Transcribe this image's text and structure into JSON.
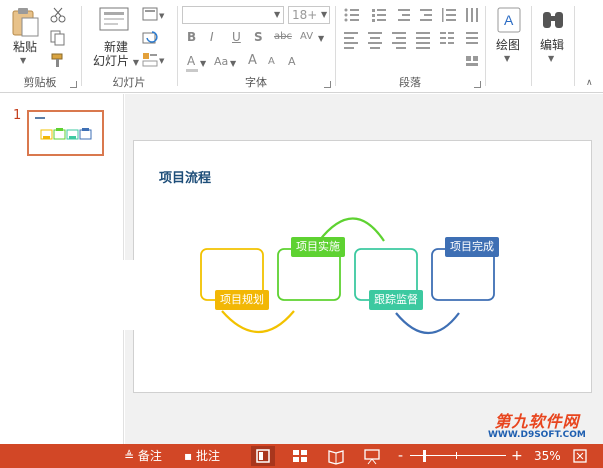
{
  "ribbon": {
    "clipboard": {
      "paste_label": "粘贴",
      "group_label": "剪贴板"
    },
    "slides": {
      "new_slide_line1": "新建",
      "new_slide_line2": "幻灯片",
      "group_label": "幻灯片"
    },
    "font": {
      "font_name": "",
      "font_size": "18+",
      "group_label": "字体",
      "bold": "B",
      "italic": "I",
      "underline": "U",
      "shadow": "S",
      "strike": "abc",
      "spacing": "AV",
      "case": "Aa",
      "grow": "A",
      "shrink": "A",
      "clear": "A"
    },
    "paragraph": {
      "group_label": "段落"
    },
    "drawing": {
      "label": "绘图"
    },
    "editing": {
      "label": "编辑"
    }
  },
  "thumbnails": {
    "slide_number": "1"
  },
  "slide": {
    "title": "项目流程",
    "steps": [
      {
        "label": "项目规划",
        "color": "#f2b705"
      },
      {
        "label": "项目实施",
        "color": "#5ed231"
      },
      {
        "label": "跟踪监督",
        "color": "#3cc9a0"
      },
      {
        "label": "项目完成",
        "color": "#3e6fb4"
      }
    ]
  },
  "statusbar": {
    "notes_label": "备注",
    "comments_label": "批注",
    "zoom_percent": "35%",
    "zoom_minus": "-",
    "zoom_plus": "+"
  },
  "watermark": {
    "line1": "第九软件网",
    "line2": "WWW.D9SOFT.COM"
  },
  "colors": {
    "accent": "#d24726",
    "thumb_border": "#d9784e",
    "title_color": "#1e4e79"
  }
}
